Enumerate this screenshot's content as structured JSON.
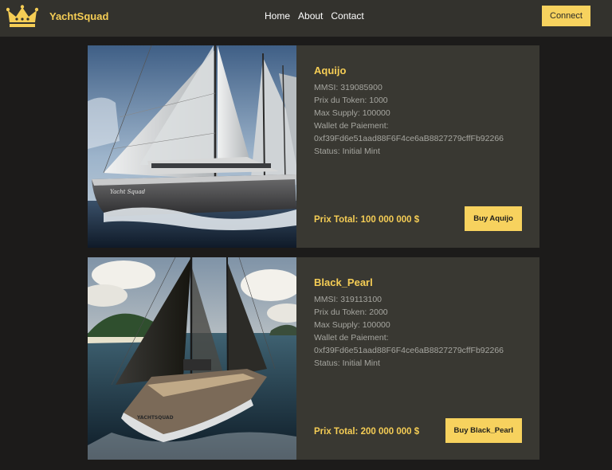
{
  "header": {
    "brand": "YachtSquad",
    "nav": [
      "Home",
      "About",
      "Contact"
    ],
    "connect_label": "Connect",
    "logo_icon": "crown-icon"
  },
  "colors": {
    "accent": "#f7d25e",
    "nav_bg": "#33322d",
    "page_bg": "#1c1b1a",
    "card_bg": "#393832"
  },
  "yachts": [
    {
      "name": "Aquijo",
      "mmsi": "MMSI: 319085900",
      "token_price": "Prix du Token: 1000",
      "max_supply": "Max Supply: 100000",
      "wallet_label": "Wallet de Paiement:",
      "wallet": "0xf39Fd6e51aad88F6F4ce6aB8827279cffFb92266",
      "status": "Status: Initial Mint",
      "total": "Prix Total: 100 000 000 $",
      "buy_label": "Buy Aquijo",
      "hull_text": "Yacht Squad"
    },
    {
      "name": "Black_Pearl",
      "mmsi": "MMSI: 319113100",
      "token_price": "Prix du Token: 2000",
      "max_supply": "Max Supply: 100000",
      "wallet_label": "Wallet de Paiement:",
      "wallet": "0xf39Fd6e51aad88F6F4ce6aB8827279cffFb92266",
      "status": "Status: Initial Mint",
      "total": "Prix Total: 200 000 000 $",
      "buy_label": "Buy Black_Pearl",
      "hull_text": "YACHTSQUAD"
    }
  ]
}
